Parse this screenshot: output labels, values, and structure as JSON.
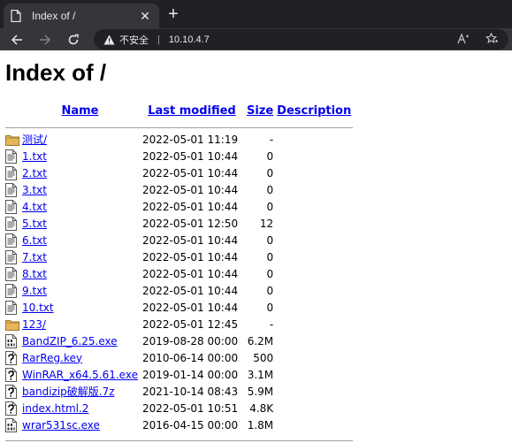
{
  "browser": {
    "tab_title": "Index of /",
    "tab_close": "✕",
    "new_tab": "+",
    "security_label": "不安全",
    "separator": "|",
    "url": "10.10.4.7"
  },
  "page": {
    "heading": "Index of /",
    "columns": {
      "name": "Name",
      "modified": "Last modified",
      "size": "Size",
      "description": "Description"
    },
    "rows": [
      {
        "icon": "folder-icon",
        "name": "测试/",
        "modified": "2022-05-01 11:19",
        "size": "-"
      },
      {
        "icon": "text-file-icon",
        "name": "1.txt",
        "modified": "2022-05-01 10:44",
        "size": "0"
      },
      {
        "icon": "text-file-icon",
        "name": "2.txt",
        "modified": "2022-05-01 10:44",
        "size": "0"
      },
      {
        "icon": "text-file-icon",
        "name": "3.txt",
        "modified": "2022-05-01 10:44",
        "size": "0"
      },
      {
        "icon": "text-file-icon",
        "name": "4.txt",
        "modified": "2022-05-01 10:44",
        "size": "0"
      },
      {
        "icon": "text-file-icon",
        "name": "5.txt",
        "modified": "2022-05-01 12:50",
        "size": "12"
      },
      {
        "icon": "text-file-icon",
        "name": "6.txt",
        "modified": "2022-05-01 10:44",
        "size": "0"
      },
      {
        "icon": "text-file-icon",
        "name": "7.txt",
        "modified": "2022-05-01 10:44",
        "size": "0"
      },
      {
        "icon": "text-file-icon",
        "name": "8.txt",
        "modified": "2022-05-01 10:44",
        "size": "0"
      },
      {
        "icon": "text-file-icon",
        "name": "9.txt",
        "modified": "2022-05-01 10:44",
        "size": "0"
      },
      {
        "icon": "text-file-icon",
        "name": "10.txt",
        "modified": "2022-05-01 10:44",
        "size": "0"
      },
      {
        "icon": "folder-icon",
        "name": "123/",
        "modified": "2022-05-01 12:45",
        "size": "-"
      },
      {
        "icon": "binary-file-icon",
        "name": "BandZIP_6.25.exe",
        "modified": "2019-08-28 00:00",
        "size": "6.2M"
      },
      {
        "icon": "unknown-file-icon",
        "name": "RarReg.key",
        "modified": "2010-06-14 00:00",
        "size": "500"
      },
      {
        "icon": "unknown-file-icon",
        "name": "WinRAR_x64.5.61.exe",
        "modified": "2019-01-14 00:00",
        "size": "3.1M"
      },
      {
        "icon": "unknown-file-icon",
        "name": "bandizip破解版.7z",
        "modified": "2021-10-14 08:43",
        "size": "5.9M"
      },
      {
        "icon": "unknown-file-icon",
        "name": "index.html.2",
        "modified": "2022-05-01 10:51",
        "size": "4.8K"
      },
      {
        "icon": "binary-file-icon",
        "name": "wrar531sc.exe",
        "modified": "2016-04-15 00:00",
        "size": "1.8M"
      }
    ]
  },
  "colors": {
    "link": "#0000ee",
    "chrome_dark": "#202124",
    "chrome_mid": "#35363a",
    "folder": "#e8b55a"
  }
}
